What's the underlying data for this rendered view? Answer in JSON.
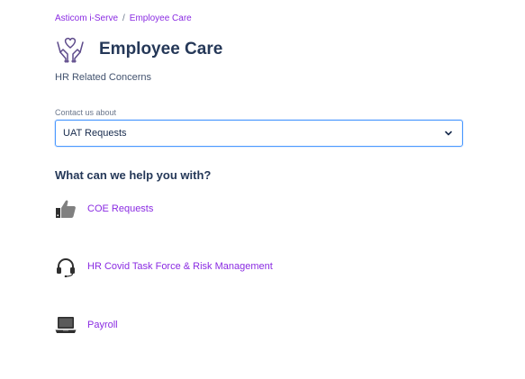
{
  "breadcrumb": {
    "root": "Asticom i-Serve",
    "separator": "/",
    "current": "Employee Care"
  },
  "header": {
    "title": "Employee Care",
    "icon": "caring-hands-heart-icon"
  },
  "subtitle": "HR Related Concerns",
  "contact": {
    "label": "Contact us about",
    "selected": "UAT Requests"
  },
  "help_heading": "What can we help you with?",
  "options": [
    {
      "label": "COE Requests",
      "icon": "thumbs-up-icon"
    },
    {
      "label": "HR Covid Task Force & Risk Management",
      "icon": "headset-icon"
    },
    {
      "label": "Payroll",
      "icon": "laptop-icon"
    }
  ],
  "colors": {
    "link": "#8a2be2",
    "heading": "#253858",
    "focus_border": "#4c9aff"
  }
}
